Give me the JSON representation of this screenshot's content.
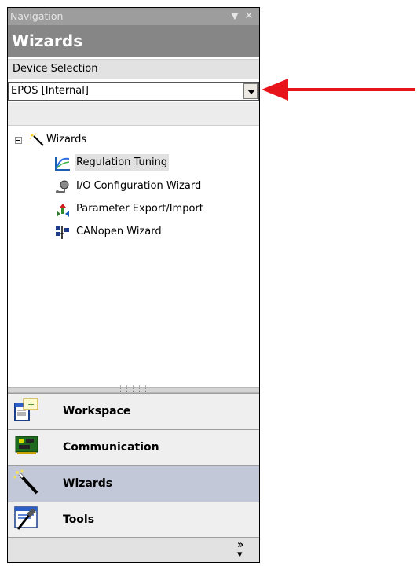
{
  "nav_header": {
    "title": "Navigation",
    "pin_icon": "pin-icon",
    "close_icon": "close-icon"
  },
  "panel_title": "Wizards",
  "device_selection": {
    "label": "Device Selection",
    "selected": "EPOS [Internal]"
  },
  "tree": {
    "root": {
      "label": "Wizards",
      "icon": "magic-wand-icon",
      "expanded": true
    },
    "items": [
      {
        "label": "Regulation Tuning",
        "icon": "tuning-chart-icon",
        "selected": true
      },
      {
        "label": "I/O Configuration Wizard",
        "icon": "io-config-icon"
      },
      {
        "label": "Parameter Export/Import",
        "icon": "export-import-icon"
      },
      {
        "label": "CANopen Wizard",
        "icon": "canopen-icon"
      }
    ]
  },
  "nav_buttons": [
    {
      "label": "Workspace",
      "icon": "workspace-icon"
    },
    {
      "label": "Communication",
      "icon": "communication-icon"
    },
    {
      "label": "Wizards",
      "icon": "magic-wand-icon",
      "active": true
    },
    {
      "label": "Tools",
      "icon": "tools-icon"
    }
  ],
  "overflow_icon": "chevron-more-icon",
  "annotation": {
    "arrow_color": "#e8141b"
  },
  "colors": {
    "active_button": "#c2c8d8",
    "header": "#868686"
  }
}
